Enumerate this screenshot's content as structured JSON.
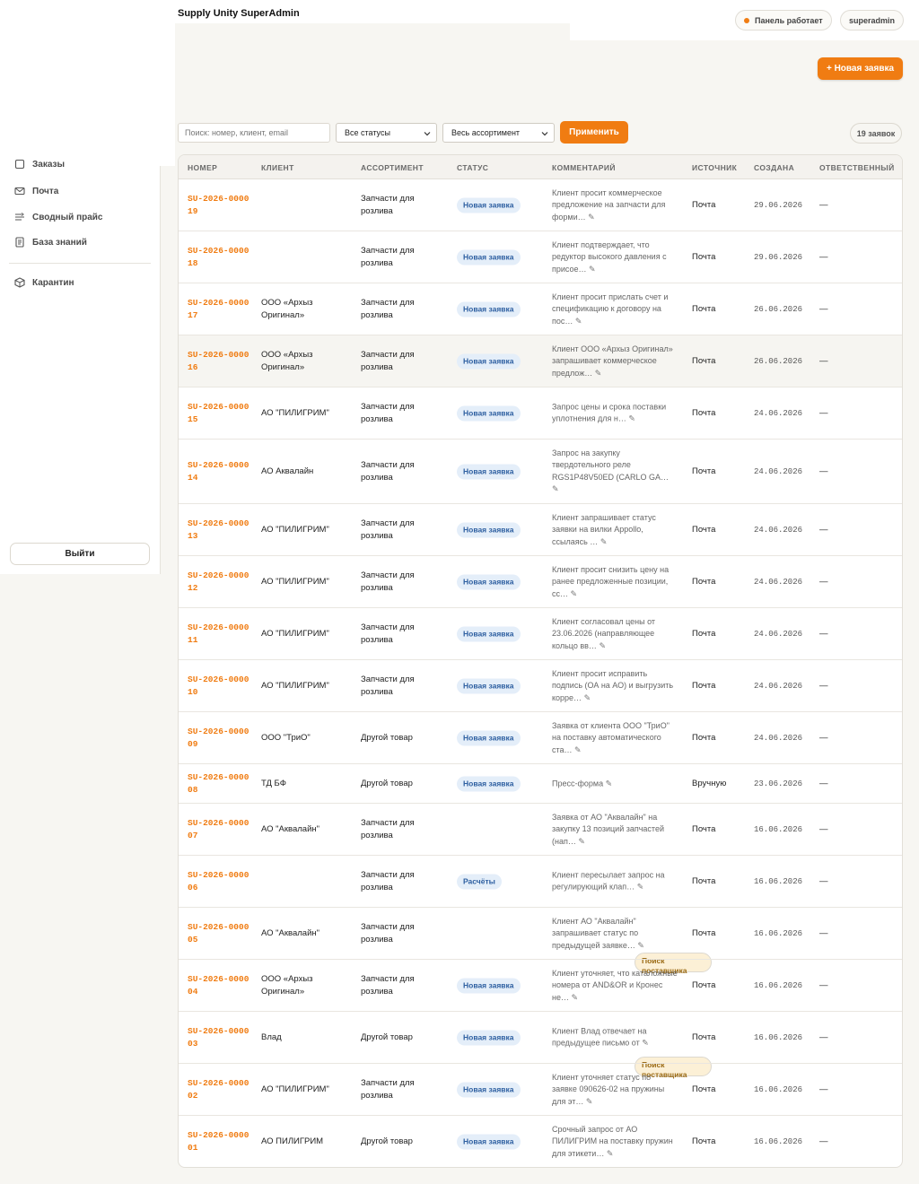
{
  "app": {
    "title": "Supply Unity SuperAdmin"
  },
  "header": {
    "status_label": "Панель работает",
    "user_label": "superadmin",
    "new_button": "+ Новая заявка"
  },
  "sidebar": {
    "items": [
      {
        "label": "Заказы",
        "icon": "orders-icon"
      },
      {
        "label": "Почта",
        "icon": "mail-icon"
      },
      {
        "label": "Сводный прайс",
        "icon": "price-icon"
      },
      {
        "label": "База знаний",
        "icon": "knowledge-icon"
      },
      {
        "label": "Карантин",
        "icon": "quarantine-icon"
      }
    ],
    "logout": "Выйти"
  },
  "filters": {
    "search_placeholder": "Поиск: номер, клиент, email",
    "status_select": "Все статусы",
    "assortment_select": "Весь ассортимент",
    "apply": "Применить",
    "count": "19 заявок"
  },
  "table": {
    "columns": [
      "НОМЕР",
      "КЛИЕНТ",
      "АССОРТИМЕНТ",
      "СТАТУС",
      "КОММЕНТАРИЙ",
      "ИСТОЧНИК",
      "СОЗДАНА",
      "ОТВЕТСТВЕННЫЙ"
    ],
    "rows": [
      {
        "num": "SU-2026-000019",
        "client": "",
        "assortment": "Запчасти для розлива",
        "status": "Новая заявка",
        "status_type": "new",
        "comment": "Клиент просит коммерческое предложение на запчасти для форми…",
        "source": "Почта",
        "created": "29.06.2026",
        "resp": "—"
      },
      {
        "num": "SU-2026-000018",
        "client": "",
        "assortment": "Запчасти для розлива",
        "status": "Новая заявка",
        "status_type": "new",
        "comment": "Клиент подтверждает, что редуктор высокого давления с присое…",
        "source": "Почта",
        "created": "29.06.2026",
        "resp": "—"
      },
      {
        "num": "SU-2026-000017",
        "client": "ООО «Архыз Оригинал»",
        "assortment": "Запчасти для розлива",
        "status": "Новая заявка",
        "status_type": "new",
        "comment": "Клиент просит прислать счет и спецификацию к договору на пос…",
        "source": "Почта",
        "created": "26.06.2026",
        "resp": "—"
      },
      {
        "num": "SU-2026-000016",
        "client": "ООО «Архыз Оригинал»",
        "assortment": "Запчасти для розлива",
        "status": "Новая заявка",
        "status_type": "new",
        "comment": "Клиент ООО «Архыз Оригинал» запрашивает коммерческое предлож…",
        "source": "Почта",
        "created": "26.06.2026",
        "resp": "—"
      },
      {
        "num": "SU-2026-000015",
        "client": "АО \"ПИЛИГРИМ\"",
        "assortment": "Запчасти для розлива",
        "status": "Новая заявка",
        "status_type": "new",
        "comment": "Запрос цены и срока поставки уплотнения для н…",
        "source": "Почта",
        "created": "24.06.2026",
        "resp": "—"
      },
      {
        "num": "SU-2026-000014",
        "client": "АО Аквалайн",
        "assortment": "Запчасти для розлива",
        "status": "Новая заявка",
        "status_type": "new",
        "comment": "Запрос на закупку твердотельного реле RGS1P48V50ED (CARLO GA…",
        "source": "Почта",
        "created": "24.06.2026",
        "resp": "—"
      },
      {
        "num": "SU-2026-000013",
        "client": "АО \"ПИЛИГРИМ\"",
        "assortment": "Запчасти для розлива",
        "status": "Новая заявка",
        "status_type": "new",
        "comment": "Клиент запрашивает статус заявки на вилки Appollo, ссылаясь …",
        "source": "Почта",
        "created": "24.06.2026",
        "resp": "—"
      },
      {
        "num": "SU-2026-000012",
        "client": "АО \"ПИЛИГРИМ\"",
        "assortment": "Запчасти для розлива",
        "status": "Новая заявка",
        "status_type": "new",
        "comment": "Клиент просит снизить цену на ранее предложенные позиции, сс…",
        "source": "Почта",
        "created": "24.06.2026",
        "resp": "—"
      },
      {
        "num": "SU-2026-000011",
        "client": "АО \"ПИЛИГРИМ\"",
        "assortment": "Запчасти для розлива",
        "status": "Новая заявка",
        "status_type": "new",
        "comment": "Клиент согласовал цены от 23.06.2026 (направляющее кольцо вв…",
        "source": "Почта",
        "created": "24.06.2026",
        "resp": "—"
      },
      {
        "num": "SU-2026-000010",
        "client": "АО \"ПИЛИГРИМ\"",
        "assortment": "Запчасти для розлива",
        "status": "Новая заявка",
        "status_type": "new",
        "comment": "Клиент просит исправить подпись (ОА на АО) и выгрузить корре…",
        "source": "Почта",
        "created": "24.06.2026",
        "resp": "—"
      },
      {
        "num": "SU-2026-000009",
        "client": "ООО \"ТриО\"",
        "assortment": "Другой товар",
        "status": "Новая заявка",
        "status_type": "new",
        "comment": "Заявка от клиента ООО \"ТриО\" на поставку автоматического ста…",
        "source": "Почта",
        "created": "24.06.2026",
        "resp": "—"
      },
      {
        "num": "SU-2026-000008",
        "client": "ТД БФ",
        "assortment": "Другой товар",
        "status": "Новая заявка",
        "status_type": "new",
        "comment": "Пресс-форма",
        "source": "Вручную",
        "created": "23.06.2026",
        "resp": "—"
      },
      {
        "num": "SU-2026-000007",
        "client": "АО \"Аквалайн\"",
        "assortment": "Запчасти для розлива",
        "status": "Поиск поставщика",
        "status_type": "search",
        "comment": "Заявка от АО \"Аквалайн\" на закупку 13 позиций запчастей (нап…",
        "source": "Почта",
        "created": "16.06.2026",
        "resp": "—"
      },
      {
        "num": "SU-2026-000006",
        "client": "",
        "assortment": "Запчасти для розлива",
        "status": "Расчёты",
        "status_type": "calc",
        "comment": "Клиент пересылает запрос на регулирующий клап…",
        "source": "Почта",
        "created": "16.06.2026",
        "resp": "—"
      },
      {
        "num": "SU-2026-000005",
        "client": "АО \"Аквалайн\"",
        "assortment": "Запчасти для розлива",
        "status": "Поиск поставщика",
        "status_type": "search",
        "comment": "Клиент АО \"Аквалайн\" запрашивает статус по предыдущей заявке…",
        "source": "Почта",
        "created": "16.06.2026",
        "resp": "—"
      },
      {
        "num": "SU-2026-000004",
        "client": "ООО «Архыз Оригинал»",
        "assortment": "Запчасти для розлива",
        "status": "Новая заявка",
        "status_type": "new",
        "comment": "Клиент уточняет, что каталожные номера от AND&OR и Кронес не…",
        "source": "Почта",
        "created": "16.06.2026",
        "resp": "—"
      },
      {
        "num": "SU-2026-000003",
        "client": "Влад",
        "assortment": "Другой товар",
        "status": "Новая заявка",
        "status_type": "new",
        "comment": "Клиент Влад отвечает на предыдущее письмо от",
        "source": "Почта",
        "created": "16.06.2026",
        "resp": "—"
      },
      {
        "num": "SU-2026-000002",
        "client": "АО \"ПИЛИГРИМ\"",
        "assortment": "Запчасти для розлива",
        "status": "Новая заявка",
        "status_type": "new",
        "comment": "Клиент уточняет статус по заявке 090626-02 на пружины для эт…",
        "source": "Почта",
        "created": "16.06.2026",
        "resp": "—"
      },
      {
        "num": "SU-2026-000001",
        "client": "АО ПИЛИГРИМ",
        "assortment": "Другой товар",
        "status": "Новая заявка",
        "status_type": "new",
        "comment": "Срочный запрос от АО ПИЛИГРИМ на поставку пружин для этикети…",
        "source": "Почта",
        "created": "16.06.2026",
        "resp": "—"
      }
    ]
  },
  "colors": {
    "accent": "#f07c12",
    "badge_new_bg": "#e4eef9",
    "badge_search_bg": "#fcf0d6"
  }
}
